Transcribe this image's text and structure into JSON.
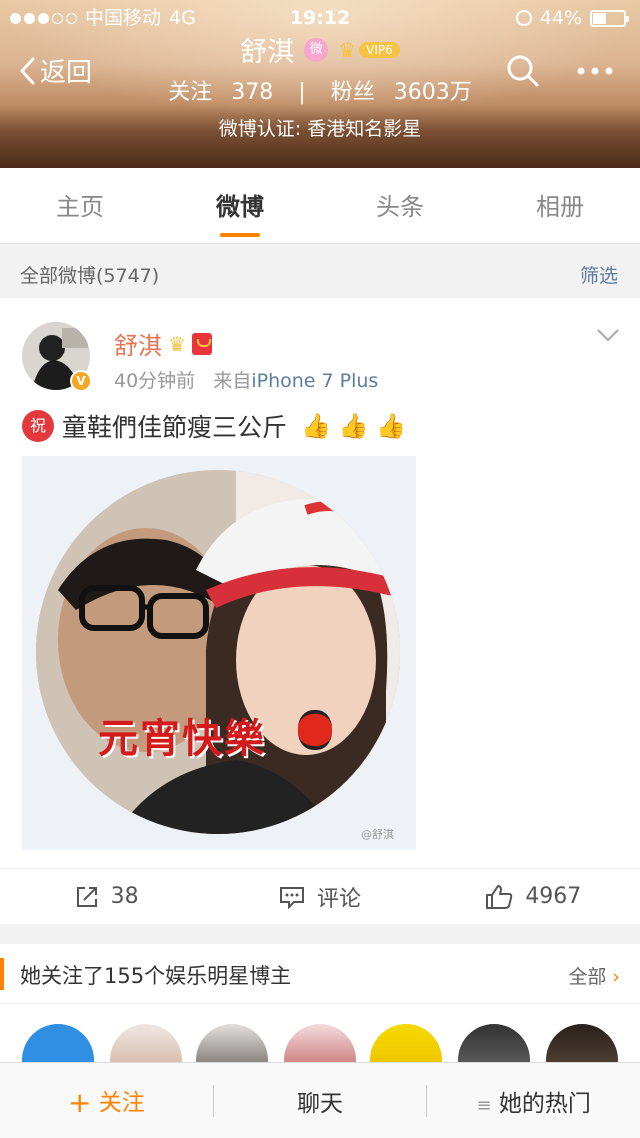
{
  "status_bar": {
    "carrier": "中国移动",
    "network": "4G",
    "time": "19:12",
    "battery": "44%"
  },
  "header": {
    "back_label": "返回",
    "profile_name": "舒淇",
    "vip_label": "VIP6",
    "following_label": "关注",
    "following_count": "378",
    "divider": "|",
    "fans_label": "粉丝",
    "fans_count": "3603万",
    "verification": "微博认证: 香港知名影星"
  },
  "tabs": [
    {
      "label": "主页",
      "active": false
    },
    {
      "label": "微博",
      "active": true
    },
    {
      "label": "头条",
      "active": false
    },
    {
      "label": "相册",
      "active": false
    }
  ],
  "filter_bar": {
    "all_label": "全部微博(5747)",
    "filter_label": "筛选"
  },
  "post": {
    "author": "舒淇",
    "time": "40分钟前",
    "source_prefix": "来自",
    "source": "iPhone 7 Plus",
    "zhu_badge": "祝",
    "text": "童鞋們佳節瘦三公斤",
    "thumbs": "👍 👍 👍",
    "image_caption": "元宵快樂",
    "image_watermark": "@舒淇",
    "reposts": "38",
    "comment_label": "评论",
    "likes": "4967"
  },
  "follows": {
    "title": "她关注了155个娱乐明星博主",
    "all_label": "全部"
  },
  "bottom_bar": {
    "follow_label": "关注",
    "chat_label": "聊天",
    "hot_label": "她的热门"
  },
  "colors": {
    "accent": "#ff8200",
    "name_orange": "#eb7350",
    "link_blue": "#5d7d9e"
  }
}
